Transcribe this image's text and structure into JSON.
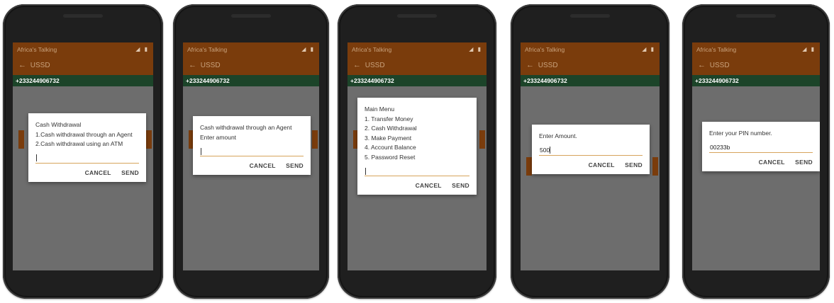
{
  "app": {
    "title": "Africa's Talking",
    "status_icons": "◢ ▮",
    "screen_title": "USSD",
    "back_icon": "←",
    "phone_number": "+233244906732"
  },
  "colors": {
    "appbar": "#7a3c0c",
    "phonebar": "#1c4429",
    "screen_bg": "#6d6d6d",
    "input_underline": "#d7a45c"
  },
  "screens": [
    {
      "lines": [
        "Cash Withdrawal",
        "1.Cash withdrawal through an Agent",
        "2.Cash withdrawal using an ATM"
      ],
      "input_value": "",
      "cancel_label": "CANCEL",
      "send_label": "SEND"
    },
    {
      "lines": [
        "Cash withdrawal through an Agent",
        "Enter amount"
      ],
      "input_value": "",
      "cancel_label": "CANCEL",
      "send_label": "SEND"
    },
    {
      "lines": [
        "Main Menu",
        "1. Transfer Money",
        "2. Cash Withdrawal",
        "3. Make Payment",
        "4. Account Balance",
        "5. Password Reset"
      ],
      "input_value": "",
      "cancel_label": "CANCEL",
      "send_label": "SEND"
    },
    {
      "lines": [
        "Enter Amount."
      ],
      "input_value": "500",
      "cancel_label": "CANCEL",
      "send_label": "SEND"
    },
    {
      "lines": [
        "Enter your PIN number."
      ],
      "input_value": "00233b",
      "cancel_label": "CANCEL",
      "send_label": "SEND"
    }
  ]
}
